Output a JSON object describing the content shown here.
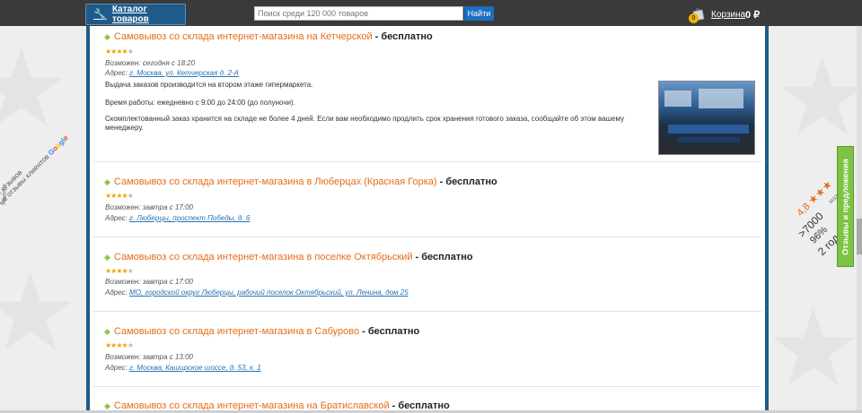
{
  "header": {
    "catalog_label": "Каталог товаров",
    "search_placeholder": "Поиск среди 120 000 товаров",
    "search_button": "Найти",
    "cart_count": "0",
    "cart_label": "Корзина",
    "cart_total": "0 ₽"
  },
  "colors": {
    "topbar": "#3a3a3a",
    "frame": "#1d5d8a",
    "title_link": "#e46d1a",
    "address_link": "#2a74b5",
    "feedback_tab": "#7dc242"
  },
  "pickup_points": [
    {
      "title": "Самовывоз со склада интернет-магазина на Кетчерской",
      "price": "- бесплатно",
      "rating": 4,
      "availability": "Возможен: сегодня с 18:20",
      "address_prefix": "Адрес:",
      "address": "г. Москва, ул. Кетчерская д. 2-А",
      "description": [
        "Выдача заказов производится на втором этаже гипермаркета.",
        "Время работы: ежедневно с 9:00 до 24:00 (до полуночи).",
        "Скомплектованный заказ хранится на складе не более 4 дней. Если вам необходимо продлить срок хранения готового заказа, сообщайте об этом вашему менеджеру."
      ],
      "has_photo": true
    },
    {
      "title": "Самовывоз со склада интернет-магазина в Люберцах (Красная Горка)",
      "price": "- бесплатно",
      "rating": 4,
      "availability": "Возможен: завтра с 17:00",
      "address_prefix": "Адрес:",
      "address": "г. Люберцы, проспект Победы, д. 6"
    },
    {
      "title": "Самовывоз со склада интернет-магазина в поселке Октябрьский",
      "price": "- бесплатно",
      "rating": 4,
      "availability": "Возможен: завтра с 17:00",
      "address_prefix": "Адрес:",
      "address": "МО, городской округ Люберцы, рабочий поселок Октябрьский, ул. Ленина, дом 25"
    },
    {
      "title": "Самовывоз со склада интернет-магазина в Сабурово",
      "price": "- бесплатно",
      "rating": 4,
      "availability": "Возможен: завтра с 13:00",
      "address_prefix": "Адрес:",
      "address": "г. Москва, Каширское шоссе, д. 53, к. 1"
    },
    {
      "title": "Самовывоз со склада интернет-магазина на Братиславской",
      "price": "- бесплатно"
    }
  ],
  "left_widget": {
    "line1": "ок",
    "line2": "ых отзывов",
    "line3": "ые отзывы клиентов",
    "google": [
      "G",
      "o",
      "o",
      "g",
      "l",
      "e"
    ],
    "nav_text": "Наверх"
  },
  "right_widget": {
    "rating": "4,8",
    "stars": "★★★",
    "count": ">7000",
    "percent": "96%",
    "years": "2 года",
    "fragment": "маз"
  },
  "feedback_tab": "Отзывы и предложения"
}
